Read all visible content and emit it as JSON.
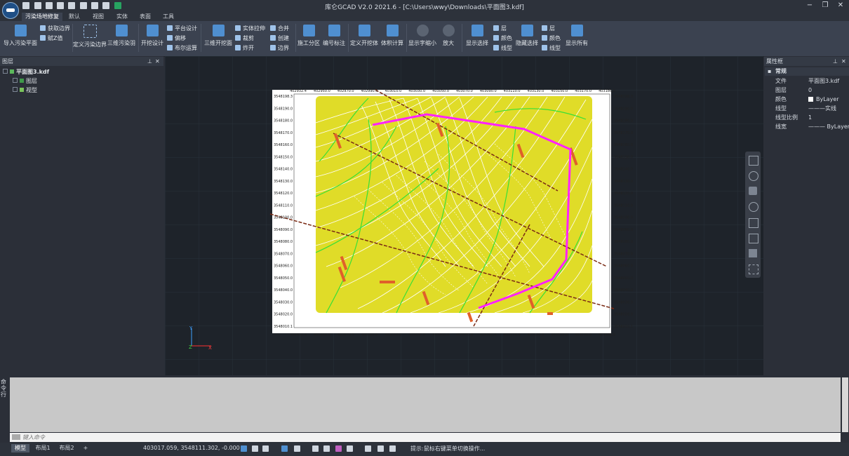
{
  "app": {
    "title": "库仑GCAD V2.0 2021.6 - [C:\\Users\\wwy\\Downloads\\平面图3.kdf]",
    "window_controls": [
      "minimize-icon",
      "restore-icon",
      "close-icon"
    ]
  },
  "menu": {
    "tabs": [
      "污染场地修复",
      "默认",
      "视图",
      "实体",
      "表面",
      "工具"
    ],
    "active_tab": "污染场地修复"
  },
  "ribbon": {
    "import_polluted_plane": "导入污染平面",
    "get_boundary": "获取边界",
    "assign_z": "赋Z值",
    "define_polluted_boundary": "定义污染边界",
    "three_d_polluted_body": "三维污染羽",
    "excavation_design": "开挖设计",
    "platform_design": "平台设计",
    "offset": "偏移",
    "boolean_op": "布尔运算",
    "three_d_excavation": "三维开挖面",
    "solid_stretch": "实体拉伸",
    "clip": "裁剪",
    "explode": "炸开",
    "merge": "合并",
    "create": "创建",
    "boundary": "边界",
    "construction_zoning": "施工分区",
    "serial_number_annotation": "编号标注",
    "define_excavation_body": "定义开挖体",
    "volume_calc": "体积计算",
    "show_font_shrink": "显示字缩小",
    "zoom_in": "放大",
    "show_select": "显示选择",
    "layer1": "层",
    "color1": "颜色",
    "linetype1": "线型",
    "hide_select": "隐藏选择",
    "layer2": "层",
    "color2": "颜色",
    "linetype2": "线型",
    "show_all": "显示所有"
  },
  "left_panel": {
    "title": "图层",
    "root": "平面图3.kdf",
    "children": [
      "图层",
      "视型"
    ]
  },
  "drawing": {
    "x_ticks": [
      "402932.4",
      "402950.0",
      "402970.0",
      "402990.0",
      "403010.0",
      "403030.0",
      "403050.0",
      "403070.0",
      "403090.0",
      "403110.0",
      "403130.0",
      "403150.0",
      "403170.0",
      "403186.9"
    ],
    "y_ticks": [
      "3548198.3",
      "3548190.0",
      "3548180.0",
      "3548170.0",
      "3548160.0",
      "3548150.0",
      "3548140.0",
      "3548130.0",
      "3548120.0",
      "3548110.0",
      "3548100.0",
      "3548090.0",
      "3548080.0",
      "3548070.0",
      "3548060.0",
      "3548050.0",
      "3548040.0",
      "3548030.0",
      "3548020.0",
      "3548010.1"
    ],
    "colors": {
      "terrain": "#e0dc28",
      "boundary": "#ff22ff",
      "contour_major": "#36e036",
      "contour_minor": "#ffffff",
      "section_line": "#7a2a14"
    }
  },
  "right_panel": {
    "title": "属性框",
    "group": "常规",
    "properties": [
      {
        "key": "文件",
        "value": "平面图3.kdf"
      },
      {
        "key": "图层",
        "value": "0"
      },
      {
        "key": "颜色",
        "value": "ByLayer"
      },
      {
        "key": "线型",
        "value": "———实线"
      },
      {
        "key": "线型比例",
        "value": "1"
      },
      {
        "key": "线宽",
        "value": "——— ByLayer"
      }
    ]
  },
  "command": {
    "side_label": "命令行",
    "placeholder": "键入命令"
  },
  "status": {
    "tabs": [
      "模型",
      "布局1",
      "布局2"
    ],
    "active_tab": "模型",
    "coordinates": "403017.059, 3548111.302, -0.000",
    "hint": "提示:鼠标右键菜单切换操作..."
  }
}
